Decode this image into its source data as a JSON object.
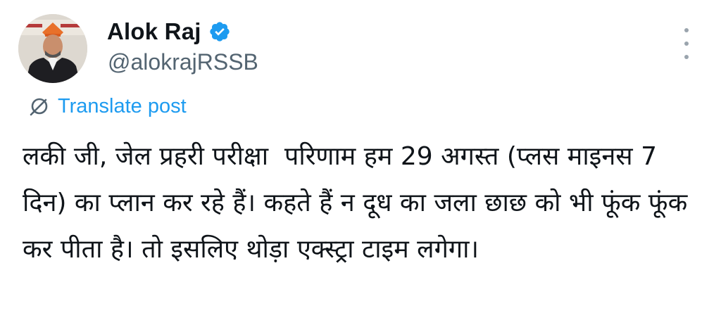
{
  "post": {
    "author": {
      "display_name": "Alok Raj",
      "handle": "@alokrajRSSB",
      "verified": true,
      "avatar": "profile-photo"
    },
    "translate_label": "Translate post",
    "text": "लकी जी, जेल प्रहरी परीक्षा  परिणाम हम 29 अगस्त (प्लस माइनस 7 दिन) का प्लान कर रहे हैं। कहते हैं न दूध का जला छाछ को भी फूंक फूंक कर पीता है। तो इसलिए थोड़ा एक्स्ट्रा टाइम लगेगा।"
  },
  "icons": {
    "verified": "verified-badge-icon",
    "more": "more-options-icon",
    "translate": "translate-globe-icon"
  },
  "colors": {
    "accent": "#1d9bf0",
    "text_primary": "#0f1419",
    "text_secondary": "#536471",
    "icon_muted": "#9aa4ad"
  }
}
